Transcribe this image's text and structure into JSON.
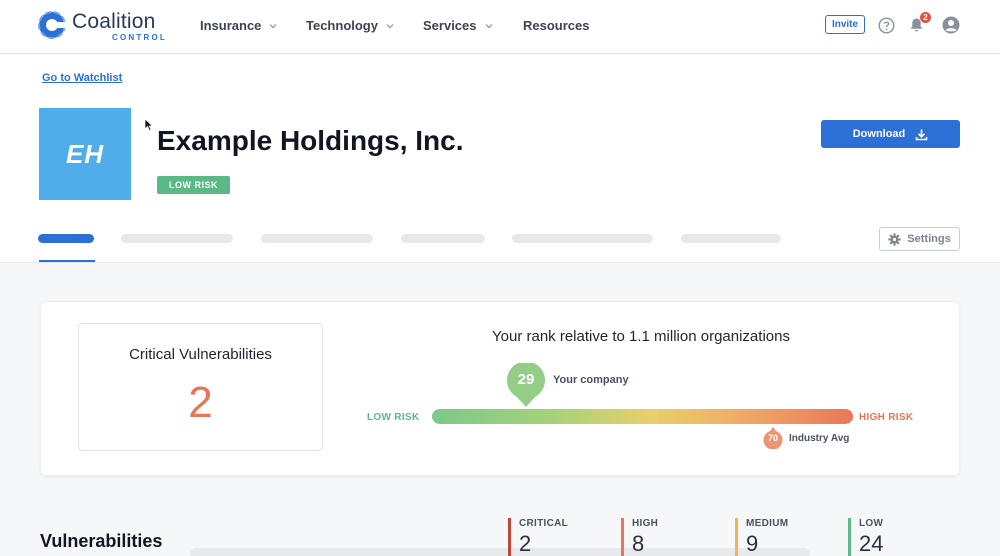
{
  "brand": {
    "name": "Coalition",
    "sub": "CONTROL",
    "accent": "#2c6fd6"
  },
  "nav": {
    "items": [
      {
        "label": "Insurance",
        "dropdown": true
      },
      {
        "label": "Technology",
        "dropdown": true
      },
      {
        "label": "Services",
        "dropdown": true
      },
      {
        "label": "Resources",
        "dropdown": false
      }
    ],
    "invite_label": "Invite",
    "notifications_count": "2",
    "icons": [
      "help-icon",
      "bell-icon",
      "user-avatar-icon"
    ]
  },
  "header": {
    "back_link": "Go to Watchlist",
    "company_initials": "EH",
    "company_name": "Example Holdings, Inc.",
    "risk_tag": "LOW RISK",
    "download_label": "Download",
    "settings_label": "Settings"
  },
  "score": {
    "critical_title": "Critical Vulnerabilities",
    "critical_value": "2",
    "rank_title": "Your rank relative to 1.1 million organizations",
    "low_label": "LOW RISK",
    "high_label": "HIGH RISK",
    "company_score": "29",
    "company_label": "Your company",
    "industry_score": "70",
    "industry_label": "Industry Avg",
    "colors": {
      "low": "#5ab987",
      "high": "#e8745a"
    }
  },
  "vulnerabilities": {
    "title": "Vulnerabilities",
    "severities": [
      {
        "label": "CRITICAL",
        "value": "2",
        "color": "#c0453a"
      },
      {
        "label": "HIGH",
        "value": "8",
        "color": "#e8745a"
      },
      {
        "label": "MEDIUM",
        "value": "9",
        "color": "#f0b455"
      },
      {
        "label": "LOW",
        "value": "24",
        "color": "#5ab987"
      }
    ]
  }
}
